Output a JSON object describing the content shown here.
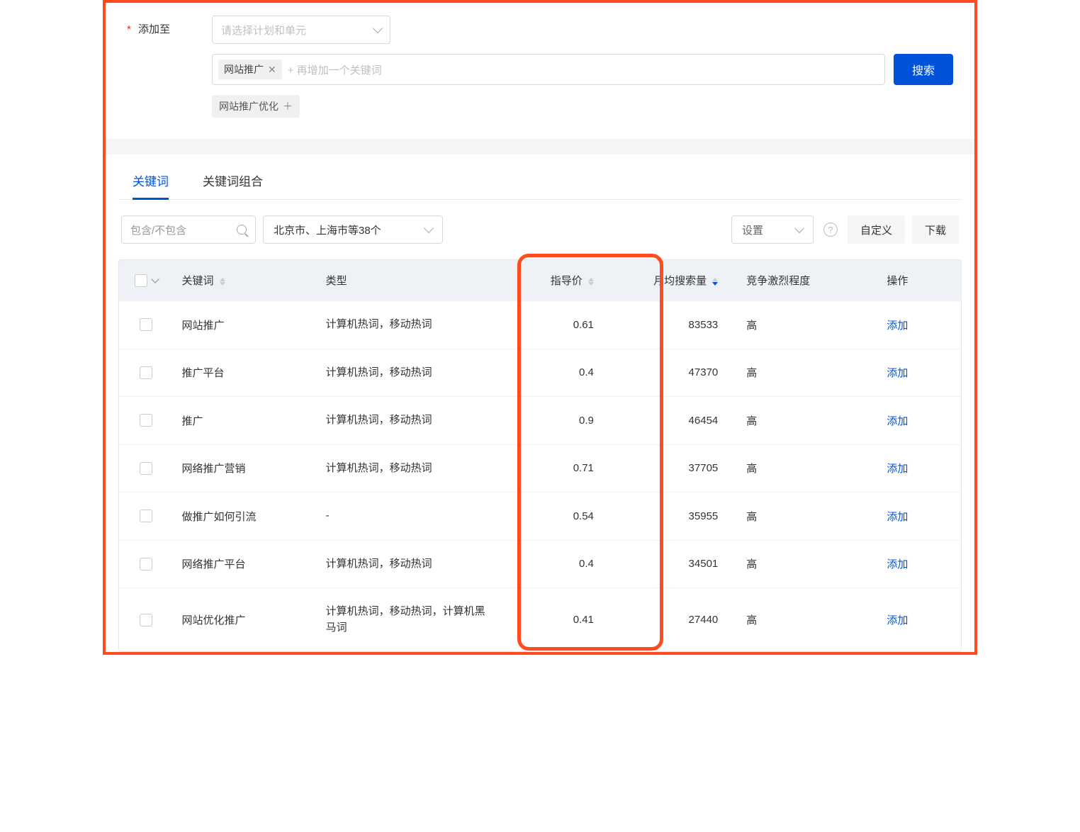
{
  "field": {
    "add_to_label": "添加至",
    "plan_placeholder": "请选择计划和单元"
  },
  "search": {
    "tag_text": "网站推广",
    "add_keyword_placeholder": "+ 再增加一个关键词",
    "button": "搜索",
    "suggestion": "网站推广优化"
  },
  "tabs": {
    "keywords": "关键词",
    "combinations": "关键词组合"
  },
  "toolbar": {
    "filter_placeholder": "包含/不包含",
    "region_label": "北京市、上海市等38个",
    "settings_label": "设置",
    "custom_btn": "自定义",
    "download_btn": "下载"
  },
  "table": {
    "headers": {
      "keyword": "关键词",
      "type": "类型",
      "guide_price": "指导价",
      "monthly_volume": "月均搜索量",
      "competition": "竞争激烈程度",
      "action": "操作"
    },
    "action_label": "添加",
    "rows": [
      {
        "keyword": "网站推广",
        "type": "计算机热词，移动热词",
        "price": "0.61",
        "volume": "83533",
        "comp": "高"
      },
      {
        "keyword": "推广平台",
        "type": "计算机热词，移动热词",
        "price": "0.4",
        "volume": "47370",
        "comp": "高"
      },
      {
        "keyword": "推广",
        "type": "计算机热词，移动热词",
        "price": "0.9",
        "volume": "46454",
        "comp": "高"
      },
      {
        "keyword": "网络推广营销",
        "type": "计算机热词，移动热词",
        "price": "0.71",
        "volume": "37705",
        "comp": "高"
      },
      {
        "keyword": "做推广如何引流",
        "type": "-",
        "price": "0.54",
        "volume": "35955",
        "comp": "高"
      },
      {
        "keyword": "网络推广平台",
        "type": "计算机热词，移动热词",
        "price": "0.4",
        "volume": "34501",
        "comp": "高"
      },
      {
        "keyword": "网站优化推广",
        "type": "计算机热词，移动热词，计算机黑马词",
        "price": "0.41",
        "volume": "27440",
        "comp": "高"
      }
    ]
  }
}
